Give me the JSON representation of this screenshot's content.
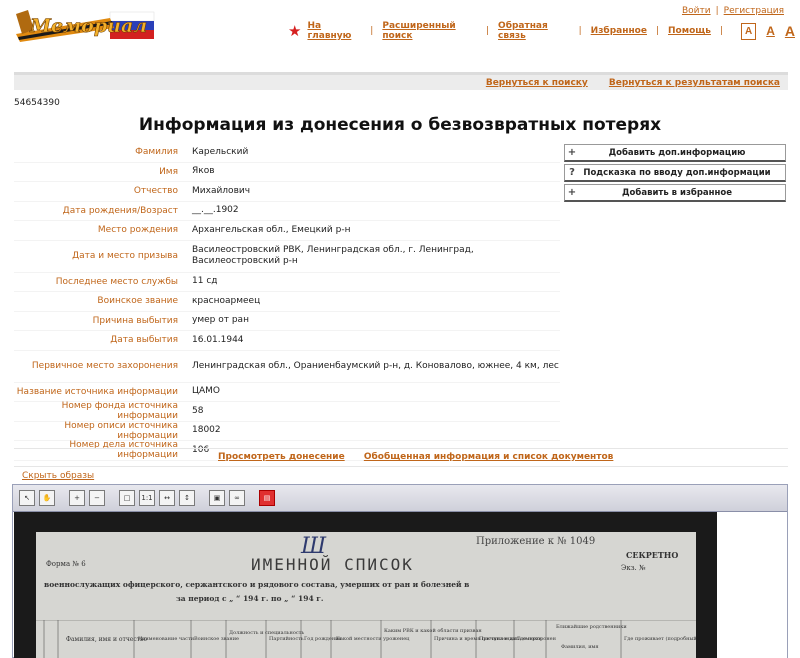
{
  "header": {
    "logo_text": "Мемориал",
    "login": "Войти",
    "register": "Регистрация",
    "nav": [
      "На главную",
      "Расширенный поиск",
      "Обратная связь",
      "Избранное",
      "Помощь"
    ],
    "font_sizes": [
      "A",
      "A",
      "A"
    ]
  },
  "back_links": [
    "Вернуться к поиску",
    "Вернуться к результатам поиска"
  ],
  "record_id": "54654390",
  "title": "Информация из донесения о безвозвратных потерях",
  "fields": [
    {
      "label": "Фамилия",
      "value": "Карельский"
    },
    {
      "label": "Имя",
      "value": "Яков"
    },
    {
      "label": "Отчество",
      "value": "Михайлович"
    },
    {
      "label": "Дата рождения/Возраст",
      "value": "__.__.1902"
    },
    {
      "label": "Место рождения",
      "value": "Архангельская обл., Емецкий р-н"
    },
    {
      "label": "Дата и место призыва",
      "value": "Василеостровский РВК, Ленинградская обл., г. Ленинград, Василеостровский р-н"
    },
    {
      "label": "Последнее место службы",
      "value": "11 сд"
    },
    {
      "label": "Воинское звание",
      "value": "красноармеец"
    },
    {
      "label": "Причина выбытия",
      "value": "умер от ран"
    },
    {
      "label": "Дата выбытия",
      "value": "16.01.1944"
    },
    {
      "label": "Первичное место захоронения",
      "value": "Ленинградская обл., Ораниенбаумский р-н, д. Коновалово, южнее, 4 км, лес"
    },
    {
      "label": "Название источника информации",
      "value": "ЦАМО"
    },
    {
      "label": "Номер фонда источника информации",
      "value": "58"
    },
    {
      "label": "Номер описи источника информации",
      "value": "18002"
    },
    {
      "label": "Номер дела источника информации",
      "value": "106"
    }
  ],
  "side_buttons": [
    {
      "icon": "+",
      "label": "Добавить доп.информацию"
    },
    {
      "icon": "?",
      "label": "Подсказка по вводу доп.информации"
    },
    {
      "icon": "+",
      "label": "Добавить в избранное"
    }
  ],
  "doc_links": [
    "Просмотреть донесение",
    "Обобщенная информация и список документов"
  ],
  "hide_images": "Скрыть образы",
  "scan": {
    "form": "Форма № 6",
    "heading": "ИМЕННОЙ СПИСОК",
    "appendix": "Приложение к № 1049",
    "secret": "СЕКРЕТНО",
    "copy": "Экз. №",
    "line1": "военнослужащих офицерского, сержантского и рядового состава, умерших от ран и болезней в",
    "period": "за период с „    “                194  г. по „    “                194  г.",
    "cols": [
      "Фамилия, имя и отчество",
      "Наименование части",
      "Воинское звание",
      "Должность и специальность",
      "Партийность",
      "Год рождения",
      "Какой местности уроженец",
      "Каким РВК и какой области призван",
      "Причина и время поступления",
      "Причина и дата смерти",
      "Где похоронен",
      "Ближайшие родственники",
      "Фамилия, имя",
      "Где проживает (подробный"
    ]
  }
}
